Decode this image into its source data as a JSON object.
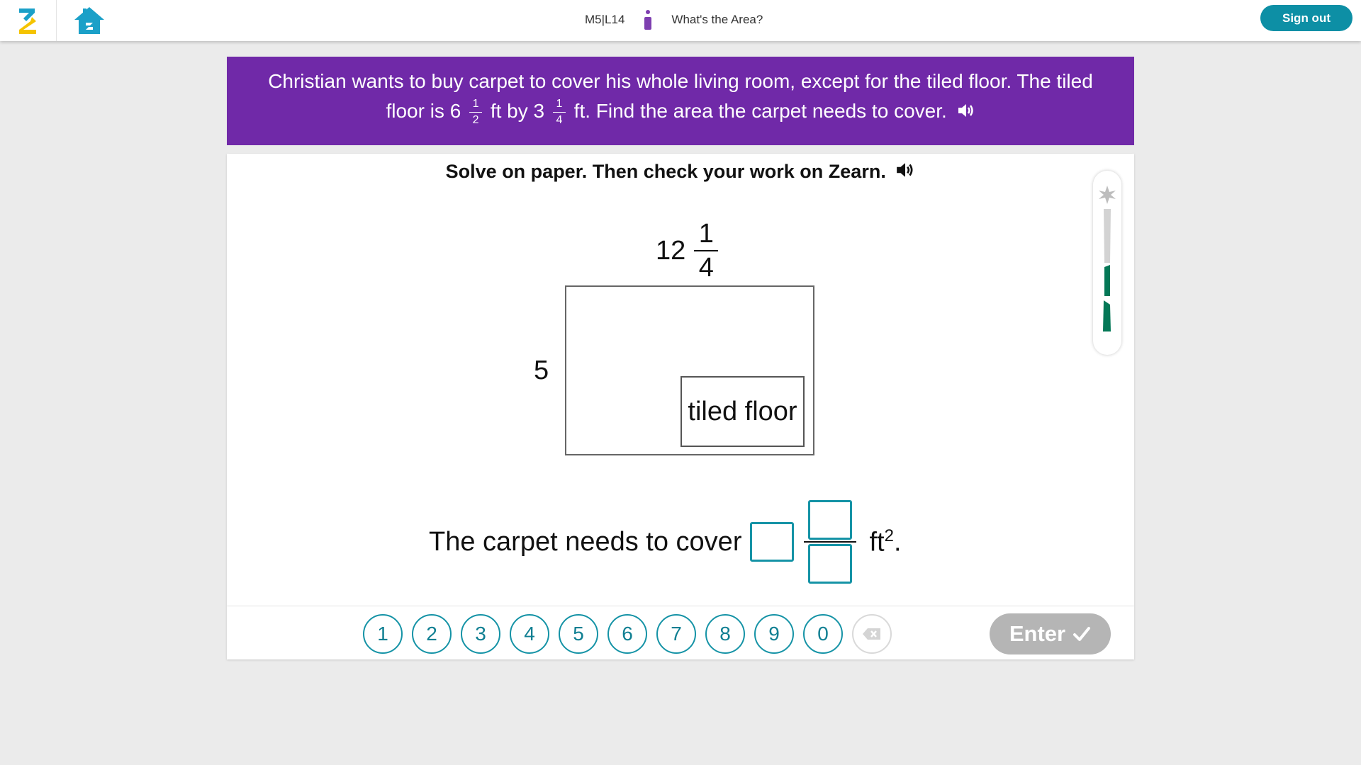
{
  "header": {
    "lesson_code": "M5|L14",
    "lesson_title": "What's the Area?",
    "sign_out_label": "Sign out",
    "icons": {
      "logo": "zearn-z-logo",
      "home": "home-icon",
      "badge": "purple-trophy-icon"
    }
  },
  "prompt": {
    "line1": "Christian wants to buy carpet to cover his whole living room, except for the tiled floor. The tiled",
    "line2_a": "floor is 6",
    "frac1_num": "1",
    "frac1_den": "2",
    "line2_b": "ft by 3",
    "frac2_num": "1",
    "frac2_den": "4",
    "line2_c": "ft. Find the area the carpet needs to cover."
  },
  "instruction": "Solve on paper. Then check your work on Zearn.",
  "diagram": {
    "top_whole": "12",
    "top_num": "1",
    "top_den": "4",
    "left_label": "5",
    "inner_label": "tiled floor"
  },
  "answer": {
    "label": "The carpet needs to cover",
    "unit": "ft",
    "unit_exp": "2",
    "period": "."
  },
  "keypad": {
    "keys": [
      "1",
      "2",
      "3",
      "4",
      "5",
      "6",
      "7",
      "8",
      "9",
      "0"
    ],
    "enter_label": "Enter"
  },
  "progress": {
    "completed_segments": 2,
    "total_segments": 3
  },
  "colors": {
    "purple_banner": "#7029a8",
    "teal": "#1593a6",
    "green_progress": "#047857",
    "enter_disabled": "#b5b5b5"
  }
}
